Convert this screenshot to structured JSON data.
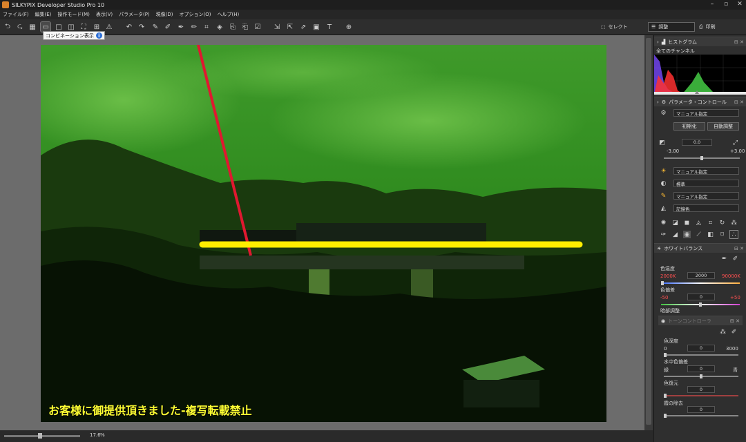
{
  "window": {
    "title": "SILKYPIX Developer Studio Pro 10",
    "controls": [
      "–",
      "▫",
      "✕"
    ]
  },
  "menu": [
    "ファイル(F)",
    "編集(E)",
    "操作モード(M)",
    "表示(V)",
    "パラメータ(P)",
    "現像(D)",
    "オプション(O)",
    "ヘルプ(H)"
  ],
  "toolbar": {
    "tooltip": "コンビネーション表示",
    "select_label": "セレクト",
    "adjust_label": "調整",
    "print_label": "印刷"
  },
  "photo": {
    "watermark": "お客様に御提供頂きました-複写転載禁止",
    "annotation_colors": {
      "line": "#e01830",
      "bar": "#ffee00"
    }
  },
  "statusbar": {
    "zoom_value": "17.6",
    "zoom_unit": "%",
    "zoom_fraction": 0.47
  },
  "panel": {
    "histogram": {
      "title": "ヒストグラム",
      "channel": "全てのチャンネル"
    },
    "params": {
      "title": "パラメータ・コントロール",
      "preset": "マニュアル指定",
      "init_btn": "初期化",
      "auto_btn": "自動調整",
      "exposure_value": "0.0",
      "exposure_min": "-3.00",
      "exposure_max": "+3.00",
      "exposure_fraction": 0.5,
      "rows": [
        {
          "icon": "sun-icon",
          "value": "マニュアル指定"
        },
        {
          "icon": "contrast-icon",
          "value": "標準"
        },
        {
          "icon": "dropper-icon",
          "value": "マニュアル指定"
        },
        {
          "icon": "sharpness-icon",
          "value": "記憶色"
        }
      ]
    },
    "white_balance": {
      "title": "ホワイトバランス",
      "temp_label": "色温度",
      "temp_min": "2000K",
      "temp_value": "2000",
      "temp_max": "90000K",
      "temp_fraction": 0.0,
      "tint_label": "色偏差",
      "tint_min": "-50",
      "tint_value": "0",
      "tint_max": "+50",
      "tint_fraction": 0.5
    },
    "shadow": {
      "title": "暗部調整",
      "sub_title": "トーンコントローラ",
      "depth_label": "色深度",
      "depth_min": "0",
      "depth_value": "0",
      "depth_max": "3000",
      "depth_fraction": 0.0,
      "hshift_label": "水中色偏差",
      "hshift_left": "緑",
      "hshift_value": "0",
      "hshift_right": "青",
      "hshift_fraction": 0.5,
      "restore_label": "色復元",
      "restore_value": "0",
      "restore_fraction": 0.0,
      "haze_label": "霞の除去",
      "haze_value": "0",
      "haze_fraction": 0.0
    }
  }
}
